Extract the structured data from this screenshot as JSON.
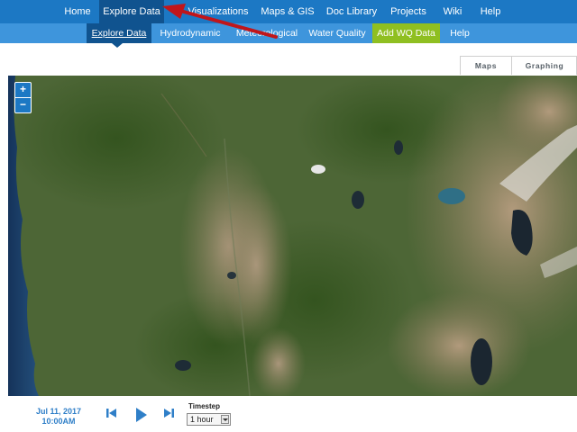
{
  "top_nav": {
    "items": [
      {
        "label": "Home"
      },
      {
        "label": "Explore Data"
      },
      {
        "label": "Visualizations"
      },
      {
        "label": "Maps & GIS"
      },
      {
        "label": "Doc Library"
      },
      {
        "label": "Projects"
      },
      {
        "label": "Wiki"
      },
      {
        "label": "Help"
      }
    ],
    "active": "Explore Data"
  },
  "sub_nav": {
    "items": [
      {
        "label": "Explore Data"
      },
      {
        "label": "Hydrodynamic"
      },
      {
        "label": "Meteorological"
      },
      {
        "label": "Water Quality"
      },
      {
        "label": "Add WQ Data"
      },
      {
        "label": "Help"
      }
    ],
    "active": "Explore Data",
    "highlight": "Add WQ Data"
  },
  "view_tabs": {
    "maps": "Maps",
    "graphing": "Graphing"
  },
  "map": {
    "zoom_in": "+",
    "zoom_out": "−"
  },
  "time_controls": {
    "date": "Jul 11, 2017",
    "time": "10:00AM",
    "timestep_label": "Timestep",
    "timestep_value": "1 hour",
    "icons": [
      "skip-back-icon",
      "play-icon",
      "skip-forward-icon"
    ]
  },
  "colors": {
    "nav": "#1c78c4",
    "nav_active": "#10538f",
    "subnav": "#3e95dc",
    "add_wq": "#8fbf21",
    "date_text": "#2f7fc8",
    "annotation_arrow": "#c0161b"
  }
}
